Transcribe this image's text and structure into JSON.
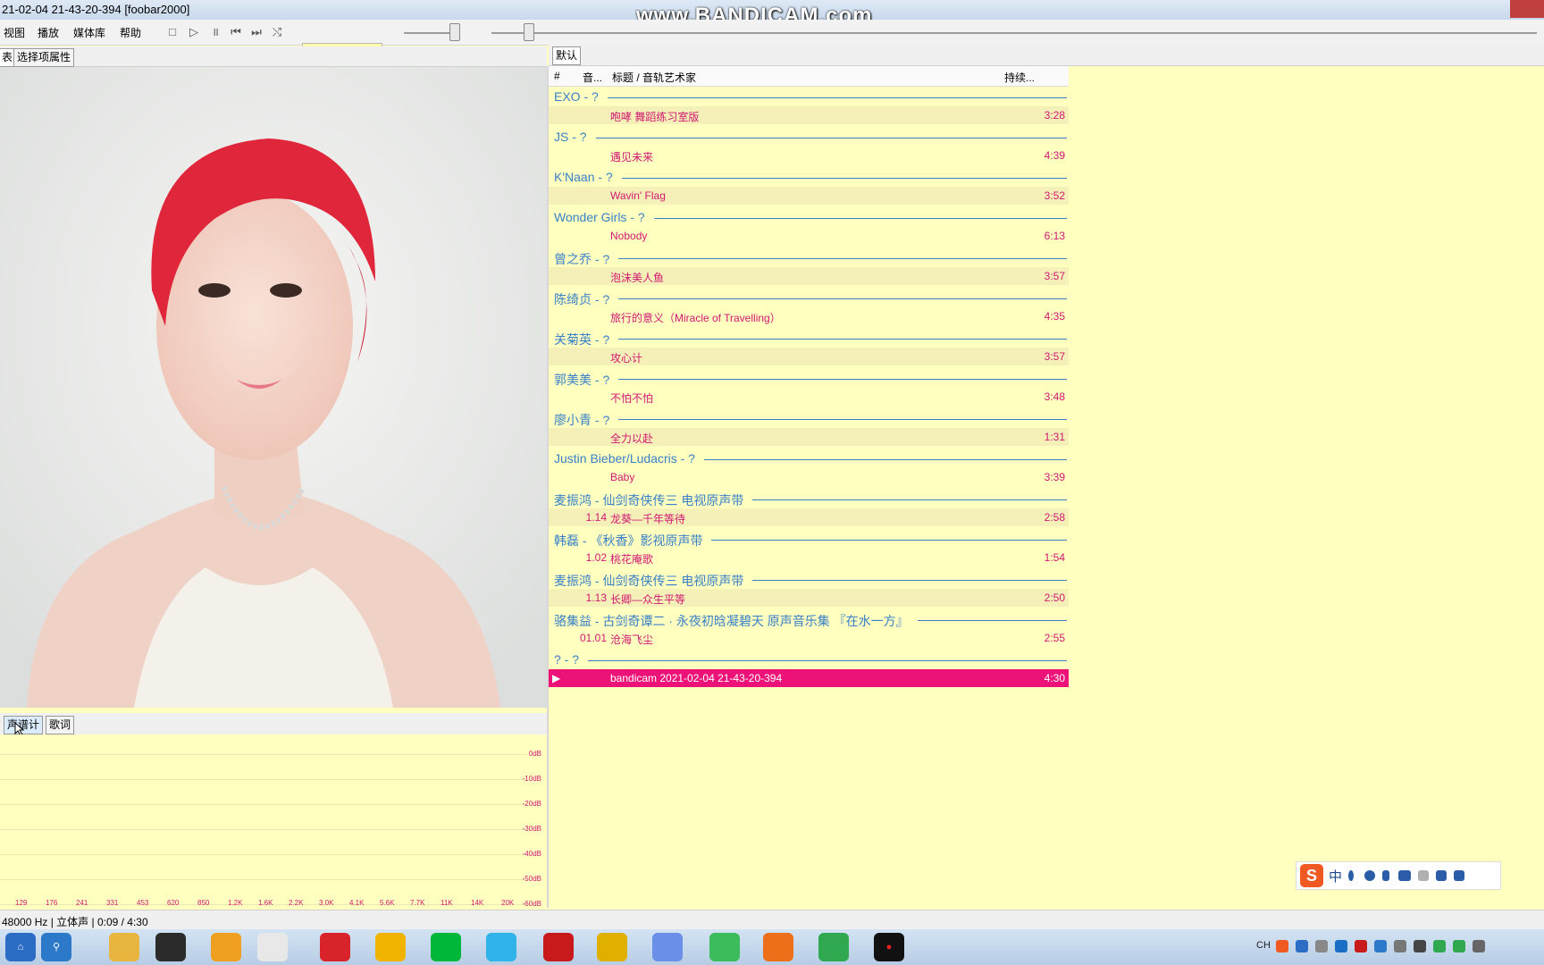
{
  "window": {
    "title": "21-02-04 21-43-20-394  [foobar2000]",
    "watermark": "www.BANDICAM.com"
  },
  "menu": {
    "items": [
      "视图",
      "播放",
      "媒体库",
      "帮助"
    ]
  },
  "toolbar": {
    "icons": [
      "stop-icon",
      "play-icon",
      "pause-icon",
      "previous-icon",
      "next-icon",
      "random-icon"
    ]
  },
  "left_tabs": {
    "partial": "表",
    "properties": "选择项属性"
  },
  "playlist": {
    "tab": "默认",
    "columns": {
      "num": "#",
      "track": "音...",
      "title": "标题 / 音轨艺术家",
      "duration": "持续..."
    },
    "groups": [
      {
        "header": "EXO - ?",
        "tracks": [
          {
            "no": "",
            "title": "咆哮 舞蹈练习室版",
            "dur": "3:28"
          }
        ]
      },
      {
        "header": "JS - ?",
        "tracks": [
          {
            "no": "",
            "title": "遇见未来",
            "dur": "4:39"
          }
        ]
      },
      {
        "header": "K'Naan - ?",
        "tracks": [
          {
            "no": "",
            "title": "Wavin' Flag",
            "dur": "3:52"
          }
        ]
      },
      {
        "header": "Wonder Girls - ?",
        "tracks": [
          {
            "no": "",
            "title": "Nobody",
            "dur": "6:13"
          }
        ]
      },
      {
        "header": "曾之乔 - ?",
        "tracks": [
          {
            "no": "",
            "title": "泡沫美人鱼",
            "dur": "3:57"
          }
        ]
      },
      {
        "header": "陈绮贞 - ?",
        "tracks": [
          {
            "no": "",
            "title": "旅行的意义（Miracle of Travelling）",
            "dur": "4:35"
          }
        ]
      },
      {
        "header": "关菊英 - ?",
        "tracks": [
          {
            "no": "",
            "title": "攻心计",
            "dur": "3:57"
          }
        ]
      },
      {
        "header": "郭美美 - ?",
        "tracks": [
          {
            "no": "",
            "title": "不怕不怕",
            "dur": "3:48"
          }
        ]
      },
      {
        "header": "廖小青 - ?",
        "tracks": [
          {
            "no": "",
            "title": "全力以赴",
            "dur": "1:31"
          }
        ]
      },
      {
        "header": "Justin Bieber/Ludacris - ?",
        "tracks": [
          {
            "no": "",
            "title": "Baby",
            "dur": "3:39"
          }
        ]
      },
      {
        "header": "麦振鸿 - 仙剑奇侠传三 电视原声带",
        "tracks": [
          {
            "no": "1.14",
            "title": "龙葵—千年等待",
            "dur": "2:58"
          }
        ]
      },
      {
        "header": "韩磊 - 《秋香》影视原声带",
        "tracks": [
          {
            "no": "1.02",
            "title": "桃花庵歌",
            "dur": "1:54"
          }
        ]
      },
      {
        "header": "麦振鸿 - 仙剑奇侠传三 电视原声带",
        "tracks": [
          {
            "no": "1.13",
            "title": "长卿—众生平等",
            "dur": "2:50"
          }
        ]
      },
      {
        "header": "骆集益 - 古剑奇谭二 · 永夜初晗凝碧天 原声音乐集 『在水一方』",
        "tracks": [
          {
            "no": "01.01",
            "title": "沧海飞尘",
            "dur": "2:55"
          }
        ]
      },
      {
        "header": "? - ?",
        "tracks": [
          {
            "no": "",
            "title": "bandicam 2021-02-04 21-43-20-394",
            "dur": "4:30",
            "playing": true
          }
        ]
      }
    ]
  },
  "bottom_tabs": {
    "spectrum": "声谱计",
    "lyrics": "歌词"
  },
  "spectrum": {
    "db_labels": [
      "0dB",
      "-10dB",
      "-20dB",
      "-30dB",
      "-40dB",
      "-50dB",
      "-60dB"
    ],
    "freq_labels": [
      "129",
      "176",
      "241",
      "331",
      "453",
      "620",
      "850",
      "1.2K",
      "1.6K",
      "2.2K",
      "3.0K",
      "4.1K",
      "5.6K",
      "7.7K",
      "11K",
      "14K",
      "20K"
    ]
  },
  "status": {
    "text": "48000 Hz | 立体声 | 0:09 / 4:30"
  },
  "ime": {
    "logo": "S",
    "mode": "中"
  },
  "tray": {
    "lang": "CH"
  },
  "colors": {
    "accent_blue": "#3a80c8",
    "track_pink": "#d01872",
    "selected": "#ec1278",
    "background": "#ffffc0"
  }
}
